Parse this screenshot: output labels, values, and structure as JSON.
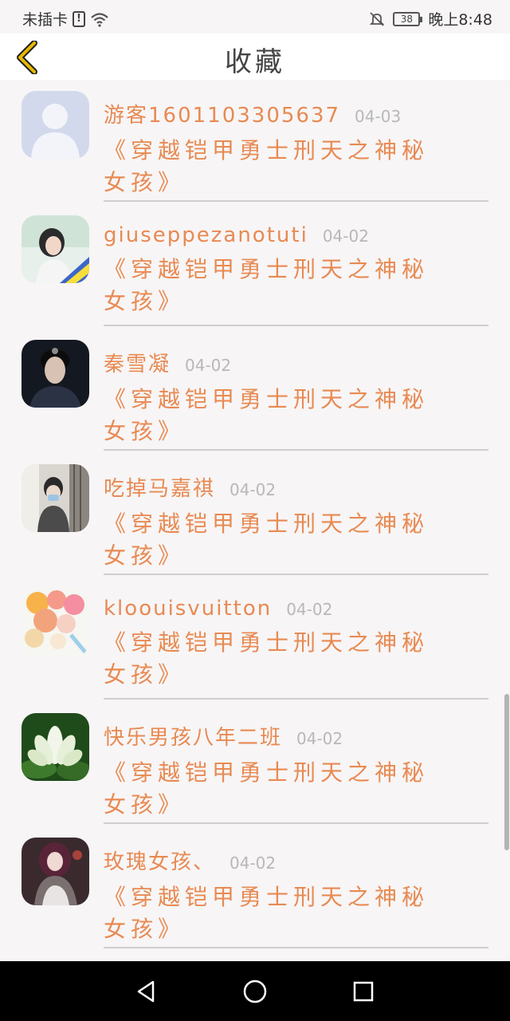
{
  "status_bar": {
    "carrier": "未插卡",
    "sim_badge": "!",
    "battery": "38",
    "time": "晚上8:48"
  },
  "header": {
    "title": "收藏"
  },
  "items": [
    {
      "name": "游客1601103305637",
      "date": "04-03",
      "title": "《穿越铠甲勇士刑天之神秘女孩》",
      "avatar": "default-avatar-icon"
    },
    {
      "name": "giuseppezanotuti",
      "date": "04-02",
      "title": "《穿越铠甲勇士刑天之神秘女孩》",
      "avatar": "girl-photo"
    },
    {
      "name": "秦雪凝",
      "date": "04-02",
      "title": "《穿越铠甲勇士刑天之神秘女孩》",
      "avatar": "man-portrait"
    },
    {
      "name": "吃掉马嘉祺",
      "date": "04-02",
      "title": "《穿越铠甲勇士刑天之神秘女孩》",
      "avatar": "masked-boy-photo"
    },
    {
      "name": "kloouisvuitton",
      "date": "04-02",
      "title": "《穿越铠甲勇士刑天之神秘女孩》",
      "avatar": "balloons-photo"
    },
    {
      "name": "快乐男孩八年二班",
      "date": "04-02",
      "title": "《穿越铠甲勇士刑天之神秘女孩》",
      "avatar": "lotus-flower-photo"
    },
    {
      "name": "玫瑰女孩、",
      "date": "04-02",
      "title": "《穿越铠甲勇士刑天之神秘女孩》",
      "avatar": "anime-girl-art"
    }
  ],
  "colors": {
    "accent": "#e88a52",
    "date": "#b8b8b8",
    "back_arrow": "#e6b800"
  }
}
